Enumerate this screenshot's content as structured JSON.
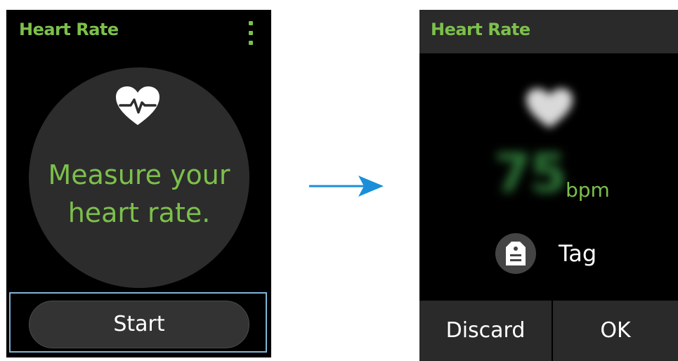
{
  "screen1": {
    "title": "Heart Rate",
    "measure_line1": "Measure your",
    "measure_line2": "heart rate.",
    "start_label": "Start"
  },
  "screen2": {
    "title": "Heart Rate",
    "hr_value": "75",
    "hr_unit": "bpm",
    "tag_label": "Tag",
    "discard_label": "Discard",
    "ok_label": "OK"
  },
  "colors": {
    "accent": "#7cc04b",
    "screen_bg": "#000000",
    "header_bg": "#2a2a2a",
    "circle_bg": "#2c2c2c",
    "highlight_frame": "#7fb5d9",
    "arrow": "#1a8fd8"
  },
  "icons": [
    "more-vert-icon",
    "heart-pulse-icon",
    "tag-icon",
    "arrow-right-icon"
  ]
}
